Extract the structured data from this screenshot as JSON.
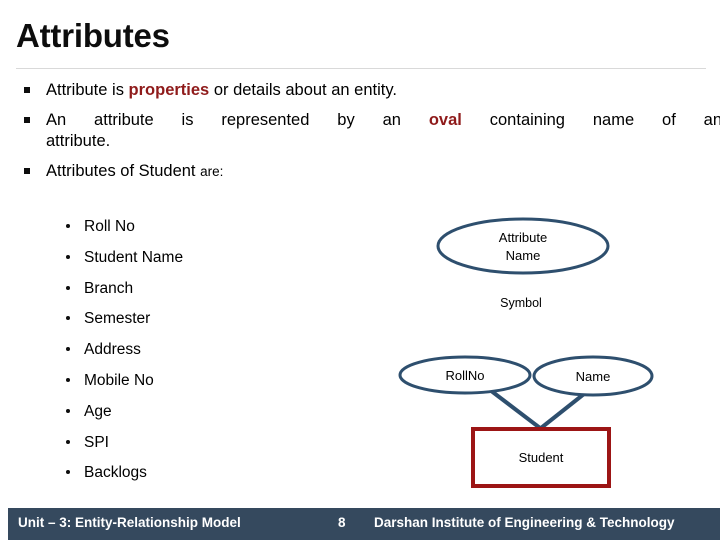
{
  "slide": {
    "title": "Attributes"
  },
  "bullets": {
    "b1": {
      "pre": "Attribute is ",
      "highlight": "properties",
      "post": " or details about an entity."
    },
    "b2": {
      "pre": "An attribute is represented by an ",
      "highlight": "oval",
      "post": " containing name of an",
      "lastline": "attribute."
    },
    "b3": {
      "main": "Attributes of Student ",
      "small": "are:"
    }
  },
  "sub_bullets": [
    {
      "label": "Roll No"
    },
    {
      "label": "Student Name"
    },
    {
      "label": "Branch"
    },
    {
      "label": "Semester"
    },
    {
      "label": "Address"
    },
    {
      "label": "Mobile No"
    },
    {
      "label": "Age"
    },
    {
      "label": "SPI"
    },
    {
      "label": "Backlogs"
    }
  ],
  "diagram": {
    "symbol_oval": {
      "line1": "Attribute",
      "line2": "Name"
    },
    "symbol_caption": "Symbol",
    "attribute_oval_1": "RollNo",
    "attribute_oval_2": "Name",
    "entity_box": "Student",
    "colors": {
      "oval_stroke": "#2e4f6e",
      "entity_stroke": "#9c1515",
      "connector": "#2e4f6e",
      "fill": "#ffffff"
    }
  },
  "footer": {
    "left": "Unit – 3: Entity-Relationship Model",
    "page": "8",
    "right": "Darshan Institute of Engineering & Technology",
    "background": "#35495e",
    "text_color": "#ffffff"
  }
}
